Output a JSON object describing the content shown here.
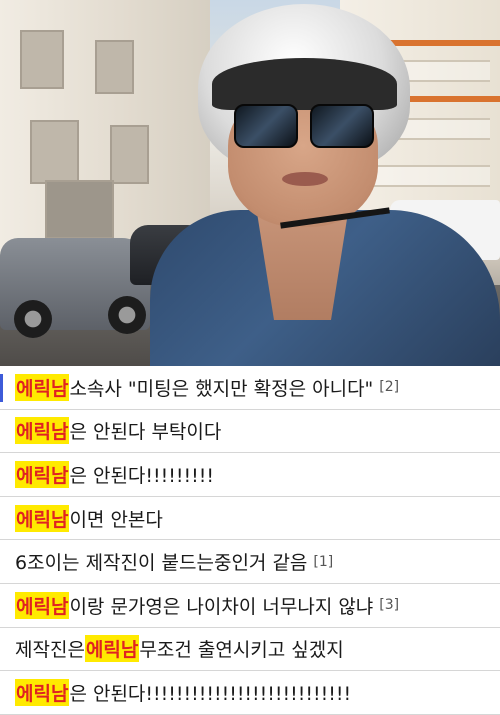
{
  "photo": {
    "description_icon": "photo-selfie-helmet"
  },
  "comments": [
    {
      "pre": "",
      "hl": "에릭남",
      "post": " 소속사 \"미팅은 했지만 확정은 아니다\"",
      "count": "[2]"
    },
    {
      "pre": "",
      "hl": "에릭남",
      "post": "은 안된다 부탁이다",
      "count": ""
    },
    {
      "pre": "",
      "hl": "에릭남",
      "post": "은 안된다!!!!!!!!!",
      "count": ""
    },
    {
      "pre": "",
      "hl": "에릭남",
      "post": "이면 안본다",
      "count": ""
    },
    {
      "pre": "6조이는 제작진이 붙드는중인거 같음",
      "hl": "",
      "post": "",
      "count": "[1]"
    },
    {
      "pre": "",
      "hl": "에릭남",
      "post": "이랑 문가영은 나이차이 너무나지 않냐",
      "count": "[3]"
    },
    {
      "pre": "제작진은 ",
      "hl": "에릭남",
      "post": " 무조건 출연시키고 싶겠지",
      "count": ""
    },
    {
      "pre": "",
      "hl": "에릭남",
      "post": "은 안된다!!!!!!!!!!!!!!!!!!!!!!!!!!!",
      "count": ""
    }
  ],
  "colors": {
    "highlight_bg": "#ffea00",
    "highlight_text": "#e02222",
    "accent_bar": "#3d5bd9"
  }
}
